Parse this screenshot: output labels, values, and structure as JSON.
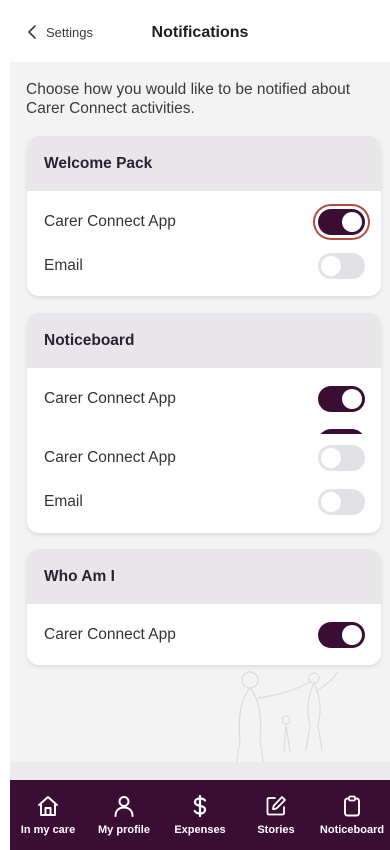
{
  "header": {
    "back_label": "Settings",
    "title": "Notifications"
  },
  "intro": "Choose how you would like to be notified about Carer Connect activities.",
  "sections": [
    {
      "title": "Welcome Pack",
      "rows": [
        {
          "label": "Carer Connect App",
          "enabled": true
        },
        {
          "label": "Email",
          "enabled": false
        }
      ]
    },
    {
      "title": "Noticeboard",
      "rows": [
        {
          "label": "Carer Connect App",
          "enabled": true
        },
        {
          "label": "Carer Connect App",
          "enabled": false
        },
        {
          "label": "Email",
          "enabled": false
        }
      ]
    },
    {
      "title": "Who Am I",
      "rows": [
        {
          "label": "Carer Connect App",
          "enabled": true
        }
      ]
    }
  ],
  "colors": {
    "brand": "#3a0d34",
    "toggle_off": "#e0e2e5",
    "highlight_ring": "#b64a3c",
    "card_header": "#e9e6ea"
  },
  "nav": [
    {
      "label": "In my care",
      "icon": "home-icon"
    },
    {
      "label": "My profile",
      "icon": "person-icon"
    },
    {
      "label": "Expenses",
      "icon": "dollar-icon"
    },
    {
      "label": "Stories",
      "icon": "edit-icon"
    },
    {
      "label": "Noticeboard",
      "icon": "clipboard-icon"
    }
  ]
}
